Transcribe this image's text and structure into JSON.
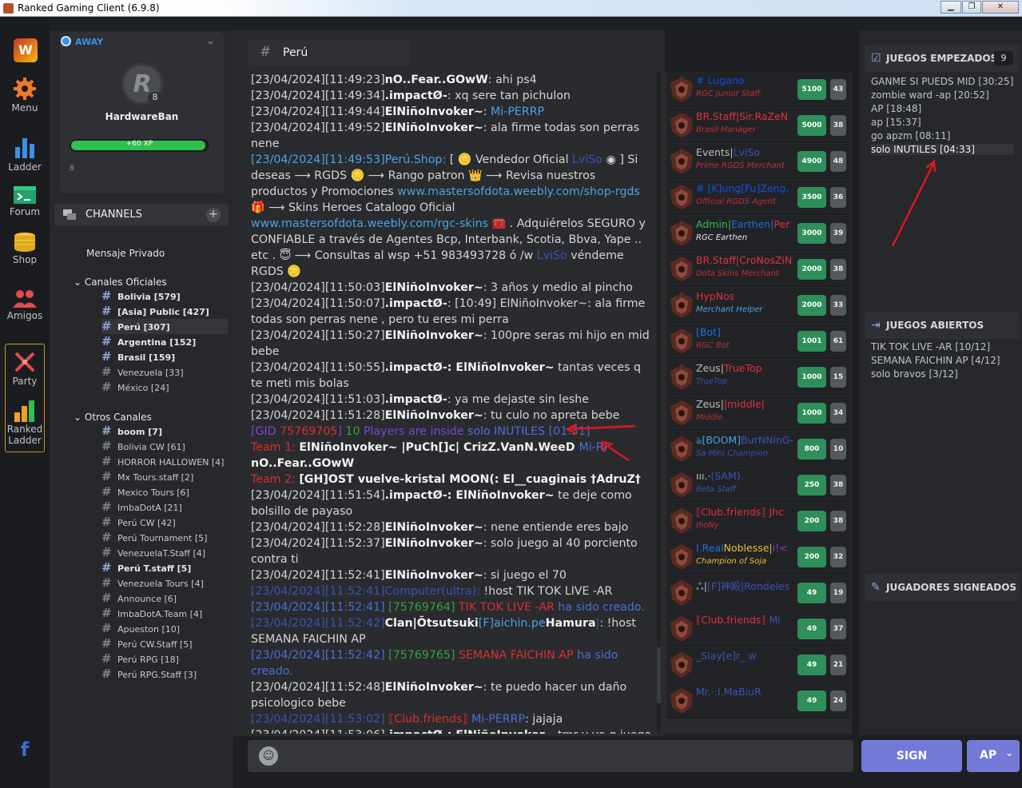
{
  "window": {
    "title": "Ranked Gaming Client (6.9.8)",
    "min": "▁",
    "max": "❐",
    "close": "✕"
  },
  "leftbar": {
    "menu": "Menu",
    "ladder": "Ladder",
    "forum": "Forum",
    "shop": "Shop",
    "amigos": "Amigos",
    "party": "Party",
    "ranked_ladder_1": "Ranked",
    "ranked_ladder_2": "Ladder",
    "facebook": "f",
    "logo": "W"
  },
  "profile": {
    "status": "AWAY",
    "username": "HardwareBan",
    "level": "8",
    "xp_label": "+60 XP",
    "xp_fraction": 0.98,
    "xp_value": "8",
    "avatar_letter": "R"
  },
  "channels": {
    "header": "CHANNELS",
    "private": "Mensaje Privado",
    "official_title": "Canales Oficiales",
    "official": [
      {
        "label": "Bolivia [579]",
        "bold": true
      },
      {
        "label": "[Asia] Public [427]",
        "bold": true
      },
      {
        "label": "Perú [307]",
        "bold": true,
        "selected": true
      },
      {
        "label": "Argentina [152]",
        "bold": true
      },
      {
        "label": "Brasil [159]",
        "bold": true
      },
      {
        "label": "Venezuela [33]",
        "bold": false
      },
      {
        "label": "México [24]",
        "bold": false
      }
    ],
    "other_title": "Otros Canales",
    "other": [
      {
        "label": "boom [7]",
        "bold": true
      },
      {
        "label": "Bolivia CW [61]",
        "bold": false
      },
      {
        "label": "HORROR HALLOWEN [4]",
        "bold": false
      },
      {
        "label": "Mx Tours.staff [2]",
        "bold": false
      },
      {
        "label": "Mexico Tours [6]",
        "bold": false
      },
      {
        "label": "ImbaDotA [21]",
        "bold": false
      },
      {
        "label": "Perú CW [42]",
        "bold": false
      },
      {
        "label": "Perú Tournament [5]",
        "bold": false
      },
      {
        "label": "VenezuelaT.Staff [4]",
        "bold": false
      },
      {
        "label": "Perú T.staff [5]",
        "bold": true
      },
      {
        "label": "Venezuela Tours [4]",
        "bold": false
      },
      {
        "label": "Announce [6]",
        "bold": false
      },
      {
        "label": "ImbaDotA.Team [4]",
        "bold": false
      },
      {
        "label": "Apueston [10]",
        "bold": false
      },
      {
        "label": "Perú CW.Staff [5]",
        "bold": false
      },
      {
        "label": "Perú RPG [18]",
        "bold": false
      },
      {
        "label": "Perú RPG.Staff [3]",
        "bold": false
      }
    ]
  },
  "chat": {
    "channel": "Perú",
    "messages": [
      [
        [
          "ts",
          "[23/04/2024][11:49:23]"
        ],
        [
          "nm",
          "nO..Fear..GOwW"
        ],
        [
          "ts",
          ": ahi ps4"
        ]
      ],
      [
        [
          "ts",
          "[23/04/2024][11:49:34]"
        ],
        [
          "nm",
          ".impactØ-"
        ],
        [
          "ts",
          ": xq sere tan pichulon"
        ]
      ],
      [
        [
          "ts",
          "[23/04/2024][11:49:44]"
        ],
        [
          "nm",
          "ElNiñoInvoker~"
        ],
        [
          "ts",
          ": "
        ],
        [
          "cyan",
          "Mi-PERRP"
        ]
      ],
      [
        [
          "ts",
          "[23/04/2024][11:49:52]"
        ],
        [
          "nm",
          "ElNiñoInvoker~"
        ],
        [
          "ts",
          ": ala firme todas son perras nene"
        ]
      ],
      [
        [
          "cyan",
          "[23/04/2024][11:49:53]"
        ],
        [
          "cyan",
          "Perú.Shop:"
        ],
        [
          "ts",
          "  [ 🪙 Vendedor Oficial "
        ],
        [
          "dim",
          "LviSo"
        ],
        [
          "ts",
          " ◉ ] Si deseas ⟶ RGDS 🪙 ⟶ Rango patron 👑 ⟶ Revisa nuestros productos y Promociones "
        ],
        [
          "cyan",
          "www.mastersofdota.weebly.com/shop-rgds"
        ],
        [
          "ts",
          " 🎁 ⟶ Skins Heroes Catalogo Oficial "
        ],
        [
          "cyan",
          "www.mastersofdota.weebly.com/rgc-skins"
        ],
        [
          "ts",
          " 🧰 . Adquiérelos SEGURO y CONFIABLE a través de Agentes Bcp, Interbank, Scotia, Bbva, Yape .. etc . 😇 ⟶ Consultas al wsp +51 983493728 ó /w "
        ],
        [
          "dim",
          "LviSo"
        ],
        [
          "ts",
          " véndeme RGDS 🪙"
        ]
      ],
      [
        [
          "ts",
          "[23/04/2024][11:50:03]"
        ],
        [
          "nm",
          "ElNiñoInvoker~"
        ],
        [
          "ts",
          ": 3 años y medio al pincho"
        ]
      ],
      [
        [
          "ts",
          "[23/04/2024][11:50:07]"
        ],
        [
          "nm",
          ".impactØ-"
        ],
        [
          "ts",
          ": [10:49] ElNiñoInvoker~: ala firme todas son perras nene , pero tu eres mi perra"
        ]
      ],
      [
        [
          "ts",
          "[23/04/2024][11:50:27]"
        ],
        [
          "nm",
          "ElNiñoInvoker~"
        ],
        [
          "ts",
          ": 100pre seras mi hijo en mid bebe"
        ]
      ],
      [
        [
          "ts",
          "[23/04/2024][11:50:55]"
        ],
        [
          "nm",
          ".impactØ-: ElNiñoInvoker~"
        ],
        [
          "ts",
          " tantas veces q te meti mis bolas"
        ]
      ],
      [
        [
          "ts",
          "[23/04/2024][11:51:03]"
        ],
        [
          "nm",
          ".impactØ-"
        ],
        [
          "ts",
          ": ya me dejaste sin leshe"
        ]
      ],
      [
        [
          "ts",
          "[23/04/2024][11:51:28]"
        ],
        [
          "nm",
          "ElNiñoInvoker~"
        ],
        [
          "ts",
          ": tu culo no apreta bebe"
        ]
      ],
      [
        [
          "purple",
          "[GID "
        ],
        [
          "red",
          "75769705"
        ],
        [
          "purple",
          "] "
        ],
        [
          "green",
          "10"
        ],
        [
          "purple",
          " Players are inside "
        ],
        [
          "blue",
          "solo INUTILES [01:31]"
        ]
      ],
      [
        [
          "red",
          "Team 1: "
        ],
        [
          "nm",
          " ElNiñoInvoker~  |PuCh[]c|  CrizZ.VanN.WeeD "
        ],
        [
          "blue",
          " Mi-RP "
        ],
        [
          "nm",
          " nO..Fear..GOwW"
        ]
      ],
      [
        [
          "red",
          "Team 2: "
        ],
        [
          "nm",
          " [GH]OST  vuelve-kristal  MOON(:  El__cuaginais  †AdruZ†"
        ]
      ],
      [
        [
          "ts",
          "[23/04/2024][11:51:54]"
        ],
        [
          "nm",
          ".impactØ-: ElNiñoInvoker~"
        ],
        [
          "ts",
          " te deje como bolsillo de payaso"
        ]
      ],
      [
        [
          "ts",
          "[23/04/2024][11:52:28]"
        ],
        [
          "nm",
          "ElNiñoInvoker~"
        ],
        [
          "ts",
          ": nene entiende eres bajo"
        ]
      ],
      [
        [
          "ts",
          "[23/04/2024][11:52:37]"
        ],
        [
          "nm",
          "ElNiñoInvoker~"
        ],
        [
          "ts",
          ": solo juego al 40 porciento contra ti"
        ]
      ],
      [
        [
          "ts",
          "[23/04/2024][11:52:41]"
        ],
        [
          "nm",
          "ElNiñoInvoker~"
        ],
        [
          "ts",
          ": si juego el 70"
        ]
      ],
      [
        [
          "dim",
          "[23/04/2024][11:52:41]"
        ],
        [
          "dim",
          "Computer(ultra):"
        ],
        [
          "ts",
          " !host TIK TOK LIVE -AR"
        ]
      ],
      [
        [
          "blue",
          "[23/04/2024][11:52:41] "
        ],
        [
          "green",
          "[75769764]"
        ],
        [
          "red",
          " TIK TOK LIVE -AR"
        ],
        [
          "blue",
          " ha sido creado."
        ]
      ],
      [
        [
          "dim",
          "[23/04/2024][11:52:42]"
        ],
        [
          "nm",
          "Clan|Ōtsutsuki"
        ],
        [
          "cyan",
          "[F]aichin.pe"
        ],
        [
          "nm",
          "Hamura"
        ],
        [
          "dim",
          "|"
        ],
        [
          "ts",
          ": !host SEMANA FAICHIN AP"
        ]
      ],
      [
        [
          "blue",
          "[23/04/2024][11:52:42] "
        ],
        [
          "green",
          "[75769765]"
        ],
        [
          "red",
          " SEMANA FAICHIN AP"
        ],
        [
          "blue",
          " ha sido creado."
        ]
      ],
      [
        [
          "ts",
          "[23/04/2024][11:52:48]"
        ],
        [
          "nm",
          "ElNiñoInvoker~"
        ],
        [
          "ts",
          ": te puedo hacer un daño psicologico bebe"
        ]
      ],
      [
        [
          "dim",
          "[23/04/2024][11:53:02]"
        ],
        [
          "red",
          " ⟦Club.friends⟧"
        ],
        [
          "blue",
          " Mi-PERRP"
        ],
        [
          "ts",
          ": jajaja"
        ]
      ],
      [
        [
          "ts",
          "[23/04/2024][11:53:06]"
        ],
        [
          "nm",
          ".impactØ-: ElNiñoInvoker~"
        ],
        [
          "ts",
          " tmr y yo q juego con una mano en la pinga"
        ]
      ]
    ]
  },
  "players": [
    {
      "n1": [
        [
          "#0a4fe0",
          "# Lugano"
        ]
      ],
      "n2": "RGC Junior Staff",
      "n2c": "#c0303a",
      "pts": "5100",
      "lv": "43"
    },
    {
      "n1": [
        [
          "#e03040",
          "BR.Staff|Sir.RaZeN"
        ]
      ],
      "n2": "Brasil Manager",
      "n2c": "#c0303a",
      "pts": "5000",
      "lv": "38"
    },
    {
      "n1": [
        [
          "#bbbbbb",
          "Events|"
        ],
        [
          "#3a53b3",
          "LviSo"
        ]
      ],
      "n2": "Prime RGDS Merchant",
      "n2c": "#c0303a",
      "pts": "4900",
      "lv": "48"
    },
    {
      "n1": [
        [
          "#1050e0",
          "# [K]ung[Fu]Zeng."
        ]
      ],
      "n2": "Official RGDS Agent",
      "n2c": "#c0303a",
      "pts": "3500",
      "lv": "36"
    },
    {
      "n1": [
        [
          "#30c050",
          "Admin|"
        ],
        [
          "#1a6ee0",
          "Earthen|"
        ],
        [
          "#e03040",
          "Per"
        ]
      ],
      "n2": "RGC Earthen",
      "n2c": "#e8e8e8",
      "pts": "3000",
      "lv": "39"
    },
    {
      "n1": [
        [
          "#e03040",
          "BR.Staff|CroNosZiN"
        ]
      ],
      "n2": "Dota Skins Merchant",
      "n2c": "#c0303a",
      "pts": "2000",
      "lv": "38"
    },
    {
      "n1": [
        [
          "#e03040",
          "HypNos"
        ]
      ],
      "n2": "Merchant Helper",
      "n2c": "#49a3e0",
      "pts": "2000",
      "lv": "33"
    },
    {
      "n1": [
        [
          "#1a6ee0",
          "[Bot]"
        ]
      ],
      "n2": "RGC Bot",
      "n2c": "#c0303a",
      "pts": "1001",
      "lv": "61"
    },
    {
      "n1": [
        [
          "#bbbbbb",
          "Zeus|"
        ],
        [
          "#e03040",
          "TrueTop"
        ]
      ],
      "n2": "TrueTop",
      "n2c": "#3a53b3",
      "pts": "1000",
      "lv": "15"
    },
    {
      "n1": [
        [
          "#bbbbbb",
          "Zeus|"
        ],
        [
          "#e03040",
          "|middle|"
        ]
      ],
      "n2": "Middle",
      "n2c": "#c0303a",
      "pts": "1000",
      "lv": "34"
    },
    {
      "n1": [
        [
          "#49a3e0",
          "ঌ[BOOM]"
        ],
        [
          "#3a53b3",
          "BurNNinG-"
        ]
      ],
      "n2": "Sa Mini Champion",
      "n2c": "#3a53b3",
      "pts": "800",
      "lv": "10"
    },
    {
      "n1": [
        [
          "#bbbbbb",
          "ııı.·"
        ],
        [
          "#3a53b3",
          "(SAM)."
        ]
      ],
      "n2": "Beta Staff",
      "n2c": "#3a53b3",
      "pts": "250",
      "lv": "38"
    },
    {
      "n1": [
        [
          "#e03040",
          "⟦Club.friends⟧ Jhc"
        ]
      ],
      "n2": "JhoNy",
      "n2c": "#c0303a",
      "pts": "200",
      "lv": "38"
    },
    {
      "n1": [
        [
          "#1a6ee0",
          "I.Real"
        ],
        [
          "#e0c030",
          "Noblesse|"
        ],
        [
          "#7d44d0",
          "ı!<"
        ]
      ],
      "n2": "Champion of Soja",
      "n2c": "#e0c030",
      "pts": "200",
      "lv": "32"
    },
    {
      "n1": [
        [
          "#bbbbbb",
          "ஃ|"
        ],
        [
          "#3a53b3",
          "[F]神殿|Rondeles"
        ]
      ],
      "n2": "",
      "n2c": "#c0303a",
      "pts": "49",
      "lv": "19"
    },
    {
      "n1": [
        [
          "#e03040",
          "⟦Club.friends⟧"
        ],
        [
          "#3a53b3",
          " Mi"
        ]
      ],
      "n2": "",
      "n2c": "#c0303a",
      "pts": "49",
      "lv": "37"
    },
    {
      "n1": [
        [
          "#3a53b3",
          "_Slay[e]r_ w"
        ]
      ],
      "n2": "",
      "n2c": "#c0303a",
      "pts": "49",
      "lv": "21"
    },
    {
      "n1": [
        [
          "#3a53b3",
          "Mr.·:I.MaBiuR"
        ]
      ],
      "n2": "",
      "n2c": "#c0303a",
      "pts": "49",
      "lv": "24"
    }
  ],
  "right": {
    "started_title": "JUEGOS EMPEZADOS",
    "started_count": "9",
    "started": [
      "GANME SI PUEDS MID [30:25]",
      "zombie ward -ap [20:52]",
      "AP [18:48]",
      "ap [15:37]",
      "go apzm [08:11]",
      "solo INUTILES [04:33]"
    ],
    "open_title": "JUEGOS ABIERTOS",
    "open": [
      "TIK TOK LIVE -AR [10/12]",
      "SEMANA FAICHIN AP [4/12]",
      "solo bravos [3/12]"
    ],
    "signed_title": "JUGADORES SIGNEADOS"
  },
  "bottom": {
    "sign": "SIGN",
    "mode": "AP",
    "emoji": "☺",
    "chevron": "⌄"
  },
  "colors": {
    "accent": "#7279d6",
    "xp": "#2fc04f",
    "away": "#3e8ee8",
    "points": "#2e8f5a",
    "annotation": "#e0161c"
  }
}
